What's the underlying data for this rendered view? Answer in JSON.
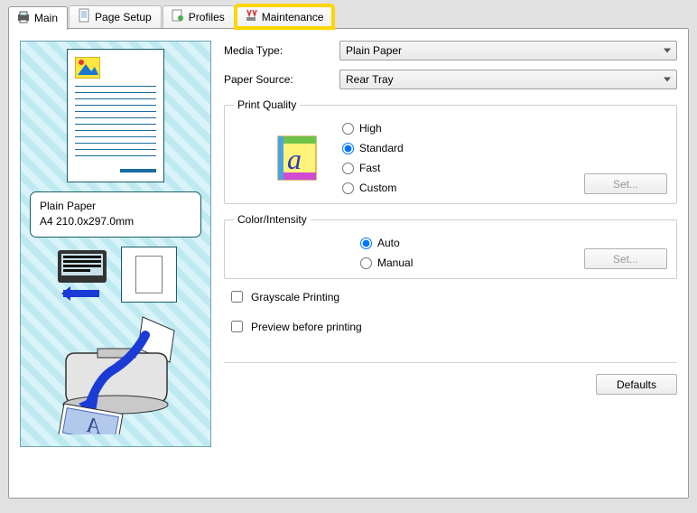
{
  "tabs": {
    "main": "Main",
    "page_setup": "Page Setup",
    "profiles": "Profiles",
    "maintenance": "Maintenance"
  },
  "labels": {
    "media_type": "Media Type:",
    "paper_source": "Paper Source:",
    "print_quality": "Print Quality",
    "color_intensity": "Color/Intensity",
    "grayscale": "Grayscale Printing",
    "preview": "Preview before printing",
    "set": "Set...",
    "defaults": "Defaults"
  },
  "values": {
    "media_type": "Plain Paper",
    "paper_source": "Rear Tray"
  },
  "print_quality": {
    "high": "High",
    "standard": "Standard",
    "fast": "Fast",
    "custom": "Custom"
  },
  "color_intensity": {
    "auto": "Auto",
    "manual": "Manual"
  },
  "paper_info": {
    "type": "Plain Paper",
    "size": "A4 210.0x297.0mm"
  }
}
